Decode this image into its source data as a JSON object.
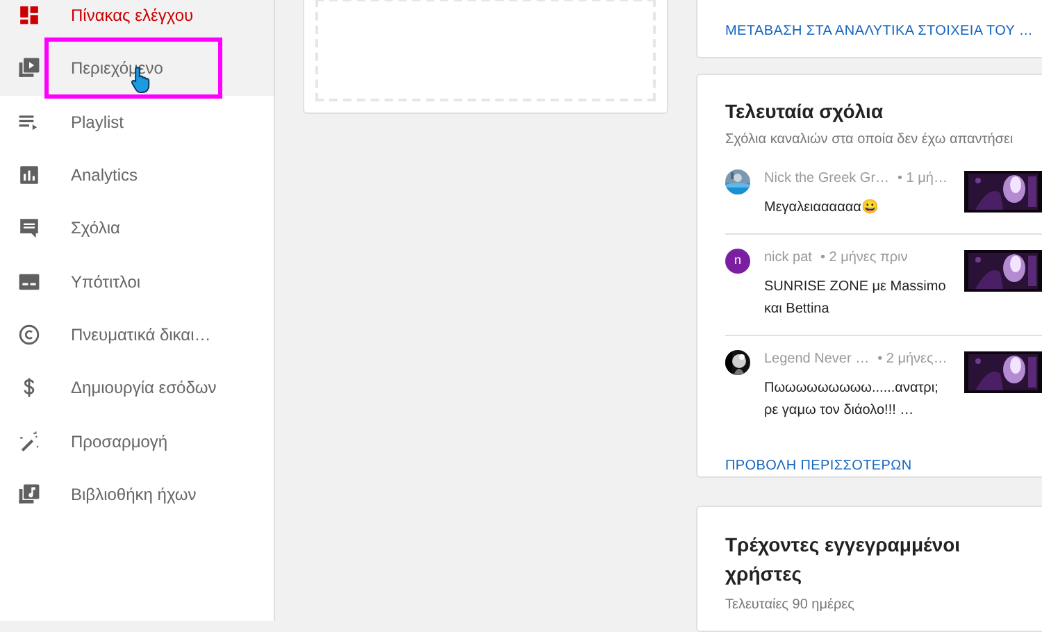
{
  "sidebar": {
    "items": [
      {
        "label": "Πίνακας ελέγχου",
        "selected": true,
        "hovered": false,
        "highlighted": false
      },
      {
        "label": "Περιεχόμενο",
        "selected": false,
        "hovered": true,
        "highlighted": true
      },
      {
        "label": "Playlist",
        "selected": false,
        "hovered": false,
        "highlighted": false
      },
      {
        "label": "Analytics",
        "selected": false,
        "hovered": false,
        "highlighted": false
      },
      {
        "label": "Σχόλια",
        "selected": false,
        "hovered": false,
        "highlighted": false
      },
      {
        "label": "Υπότιτλοι",
        "selected": false,
        "hovered": false,
        "highlighted": false
      },
      {
        "label": "Πνευματικά δικαι…",
        "selected": false,
        "hovered": false,
        "highlighted": false
      },
      {
        "label": "Δημιουργία εσόδων",
        "selected": false,
        "hovered": false,
        "highlighted": false
      },
      {
        "label": "Προσαρμογή",
        "selected": false,
        "hovered": false,
        "highlighted": false
      },
      {
        "label": "Βιβλιοθήκη ήχων",
        "selected": false,
        "hovered": false,
        "highlighted": false
      }
    ]
  },
  "analytics_card": {
    "link": "ΜΕΤΑΒΑΣΗ ΣΤΑ ΑΝΑΛΥΤΙΚΑ ΣΤΟΙΧΕΙΑ ΤΟΥ …"
  },
  "comments_card": {
    "title": "Τελευταία σχόλια",
    "subtitle": "Σχόλια καναλιών στα οποία δεν έχω απαντήσει",
    "comments": [
      {
        "avatar": {
          "kind": "picture"
        },
        "author": "Nick the Greek Gr…",
        "time": "• 1 μή…",
        "lines": [
          "Μεγαλειαααααα😀"
        ]
      },
      {
        "avatar": {
          "kind": "letter",
          "letter": "n",
          "color": "#7b1fa2"
        },
        "author": "nick pat",
        "time": "• 2 μήνες πριν",
        "lines": [
          "SUNRISE ZONE με Massimo",
          "και Bettina"
        ]
      },
      {
        "avatar": {
          "kind": "picture"
        },
        "author": "Legend Never …",
        "time": "• 2 μήνες…",
        "lines": [
          "Πωωωωωωωωω......ανατρι;",
          "ρε γαμω τον διάολο!!! …"
        ]
      }
    ],
    "more_link": "ΠΡΟΒΟΛΗ ΠΕΡΙΣΣΟΤΕΡΩΝ"
  },
  "subscribers_card": {
    "title": "Τρέχοντες εγγεγραμμένοι χρήστες",
    "subtitle": "Τελευταίες 90 ημέρες"
  }
}
